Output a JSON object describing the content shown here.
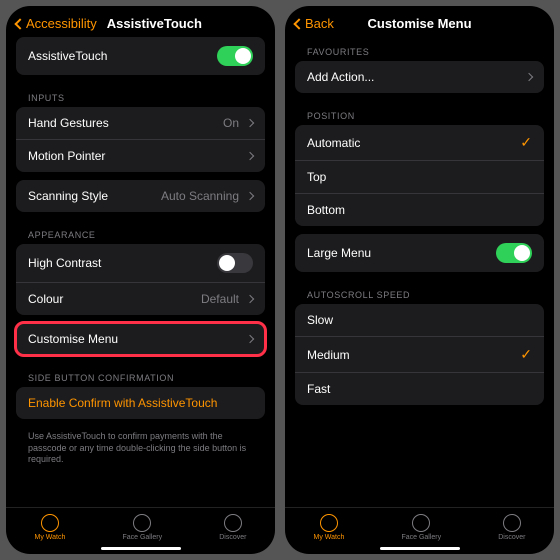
{
  "left": {
    "back_label": "Accessibility",
    "title": "AssistiveTouch",
    "toggle_label": "AssistiveTouch",
    "sections": {
      "inputs_label": "INPUTS",
      "hand_gestures": {
        "label": "Hand Gestures",
        "value": "On"
      },
      "motion_pointer": {
        "label": "Motion Pointer"
      },
      "scanning": {
        "label": "Scanning Style",
        "value": "Auto Scanning"
      },
      "appearance_label": "APPEARANCE",
      "high_contrast": {
        "label": "High Contrast"
      },
      "colour": {
        "label": "Colour",
        "value": "Default"
      },
      "customise": {
        "label": "Customise Menu"
      },
      "side_label": "SIDE BUTTON CONFIRMATION",
      "enable_confirm": {
        "label": "Enable Confirm with AssistiveTouch"
      },
      "desc": "Use AssistiveTouch to confirm payments with the passcode or any time double-clicking the side button is required."
    }
  },
  "right": {
    "back_label": "Back",
    "title": "Customise Menu",
    "sections": {
      "fav_label": "FAVOURITES",
      "add_action": {
        "label": "Add Action..."
      },
      "pos_label": "POSITION",
      "pos_opts": [
        "Automatic",
        "Top",
        "Bottom"
      ],
      "pos_selected": 0,
      "large_menu": {
        "label": "Large Menu"
      },
      "speed_label": "AUTOSCROLL SPEED",
      "speed_opts": [
        "Slow",
        "Medium",
        "Fast"
      ],
      "speed_selected": 1
    }
  },
  "tabs": [
    "My Watch",
    "Face Gallery",
    "Discover"
  ]
}
